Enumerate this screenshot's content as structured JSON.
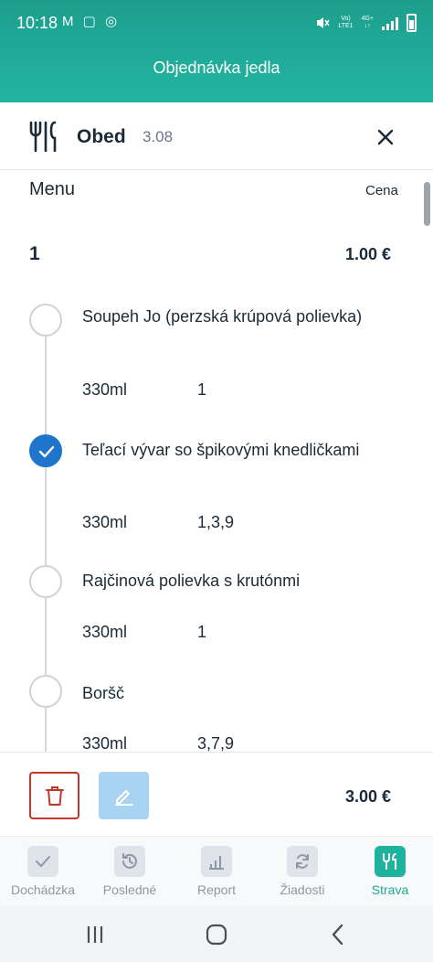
{
  "status_bar": {
    "time": "10:18",
    "left_icons": "M ▢ ◎",
    "volte_line1": "Vo)",
    "volte_line2": "LTE1",
    "net_line1": "4G+",
    "net_line2": "↓↑"
  },
  "header": {
    "title": "Objednávka jedla",
    "color": "#1fae9b"
  },
  "card": {
    "meal_icon": "fork-knife-icon",
    "meal_name": "Obed",
    "date": "3.08",
    "close_icon": "close-icon"
  },
  "menu": {
    "label": "Menu",
    "price_label": "Cena",
    "group": {
      "number": "1",
      "price": "1.00 €"
    },
    "items": [
      {
        "name": "Soupeh Jo (perzská krúpová polievka)",
        "volume": "330ml",
        "allergens": "1",
        "selected": false
      },
      {
        "name": "Teľací vývar so špikovými knedličkami",
        "volume": "330ml",
        "allergens": "1,3,9",
        "selected": true
      },
      {
        "name": "Rajčinová polievka s krutónmi",
        "volume": "330ml",
        "allergens": "1",
        "selected": false
      },
      {
        "name": "Boršč",
        "volume": "330ml",
        "allergens": "3,7,9",
        "selected": false
      }
    ]
  },
  "actions": {
    "delete_icon": "trash-icon",
    "edit_icon": "pencil-icon",
    "total": "3.00 €"
  },
  "bottom_nav": {
    "active_color": "#1fb39f",
    "items": [
      {
        "label": "Dochádzka",
        "icon": "check-icon",
        "active": false
      },
      {
        "label": "Posledné",
        "icon": "history-icon",
        "active": false
      },
      {
        "label": "Report",
        "icon": "bar-chart-icon",
        "active": false
      },
      {
        "label": "Žiadosti",
        "icon": "sync-icon",
        "active": false
      },
      {
        "label": "Strava",
        "icon": "fork-knife-icon",
        "active": true
      }
    ]
  }
}
